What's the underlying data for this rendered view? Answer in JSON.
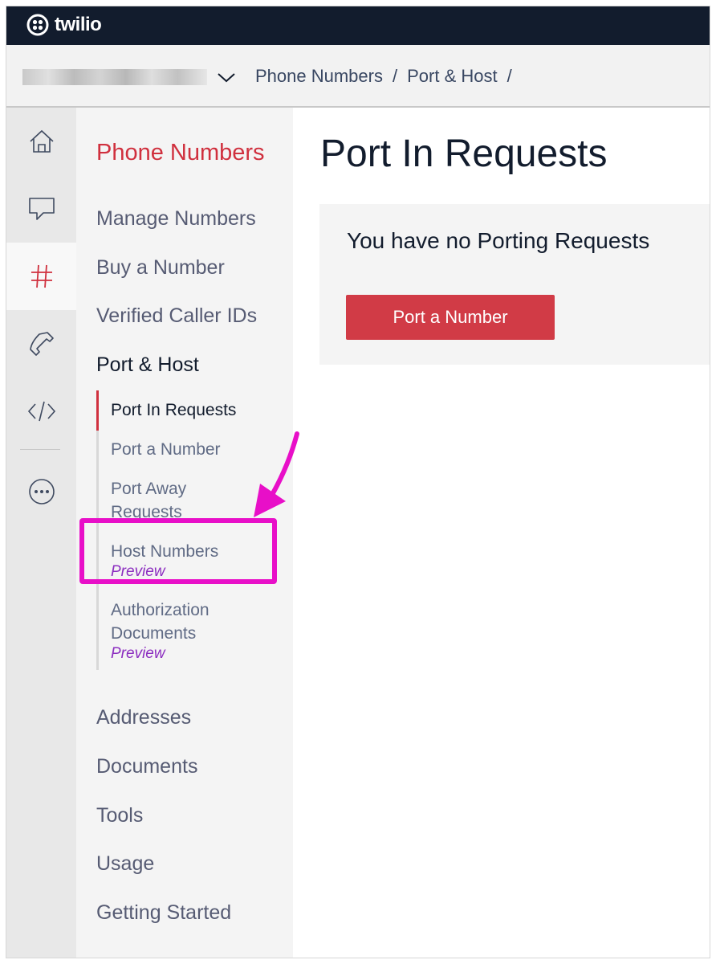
{
  "brand": {
    "name": "twilio",
    "color": "#f22f46"
  },
  "breadcrumb": {
    "items": [
      "Phone Numbers",
      "/",
      "Port & Host",
      "/"
    ]
  },
  "rail": {
    "icons": [
      "home-icon",
      "chat-icon",
      "hash-icon",
      "phone-icon",
      "code-icon",
      "more-icon"
    ],
    "active": "hash-icon"
  },
  "subnav": {
    "title": "Phone Numbers",
    "items": [
      "Manage Numbers",
      "Buy a Number",
      "Verified Caller IDs"
    ],
    "group": {
      "label": "Port & Host",
      "children": [
        {
          "label": "Port In Requests",
          "badge": ""
        },
        {
          "label": "Port a Number",
          "badge": ""
        },
        {
          "label": "Port Away Requests",
          "badge": ""
        },
        {
          "label": "Host Numbers",
          "badge": "Preview"
        },
        {
          "label": "Authorization Documents",
          "badge": "Preview"
        }
      ]
    },
    "bottom_items": [
      "Addresses",
      "Documents",
      "Tools",
      "Usage",
      "Getting Started"
    ]
  },
  "main": {
    "title": "Port In Requests",
    "empty_message": "You have no Porting Requests",
    "cta_label": "Port a Number"
  },
  "colors": {
    "accent": "#d0303e",
    "topbar": "#121c2d",
    "preview": "#8c2ec0",
    "annotation": "#e80fc8"
  }
}
